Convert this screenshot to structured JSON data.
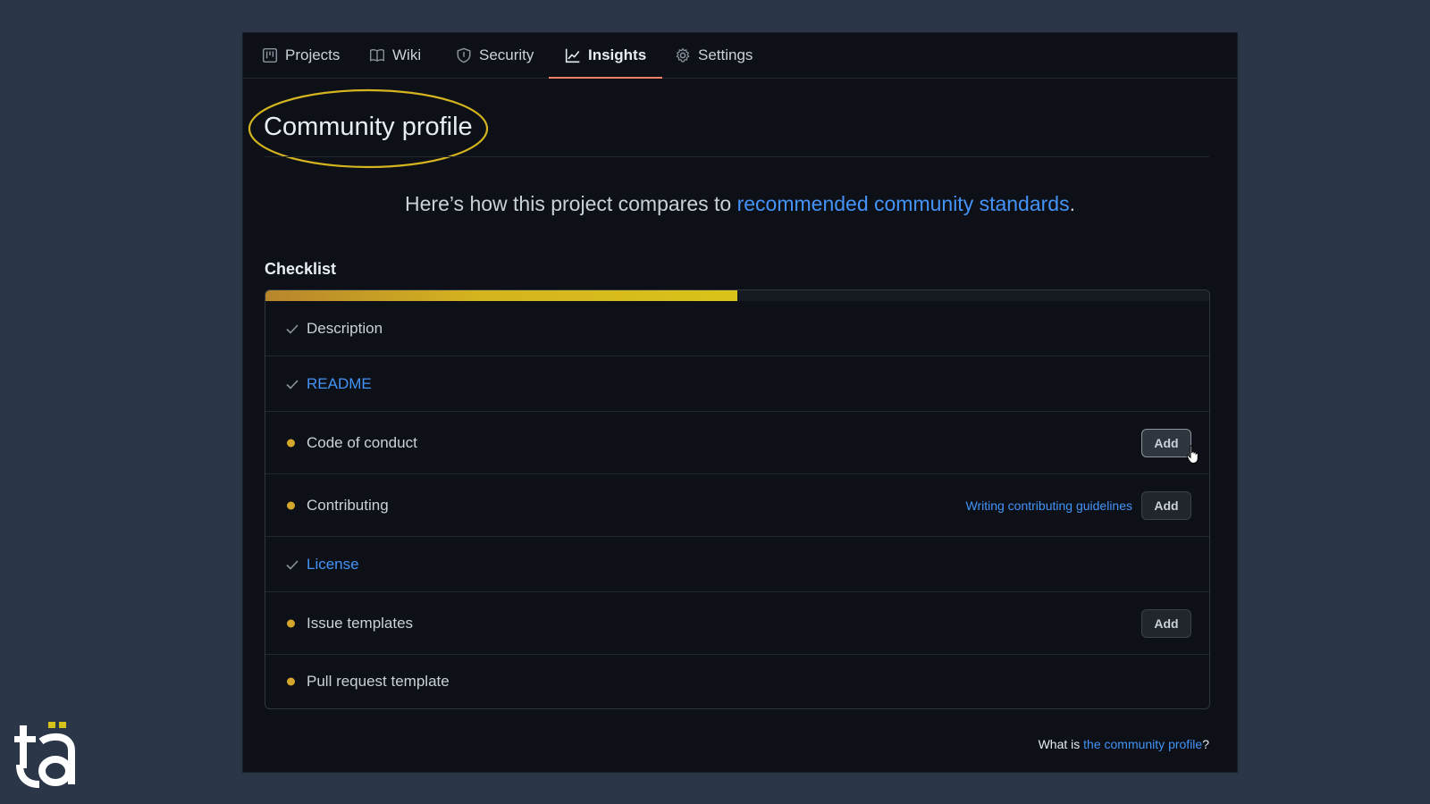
{
  "tabs": [
    {
      "label": "Projects",
      "icon": "project-icon"
    },
    {
      "label": "Wiki",
      "icon": "book-icon"
    },
    {
      "label": "Security",
      "icon": "shield-icon"
    },
    {
      "label": "Insights",
      "icon": "graph-icon",
      "active": true
    },
    {
      "label": "Settings",
      "icon": "gear-icon"
    }
  ],
  "page": {
    "title": "Community profile",
    "intro_text": "Here’s how this project compares to ",
    "intro_link": "recommended community standards",
    "intro_end": "."
  },
  "checklist": {
    "heading": "Checklist",
    "progress_fraction": 0.5,
    "items": [
      {
        "label": "Description",
        "status": "done",
        "link": false
      },
      {
        "label": "README",
        "status": "done",
        "link": true
      },
      {
        "label": "Code of conduct",
        "status": "missing",
        "link": false,
        "action": "Add"
      },
      {
        "label": "Contributing",
        "status": "missing",
        "link": false,
        "action": "Add",
        "guide": "Writing contributing guidelines"
      },
      {
        "label": "License",
        "status": "done",
        "link": true
      },
      {
        "label": "Issue templates",
        "status": "missing",
        "link": false,
        "action": "Add"
      },
      {
        "label": "Pull request template",
        "status": "missing",
        "link": false
      }
    ]
  },
  "footer": {
    "prefix": "What is ",
    "link": "the community profile",
    "suffix": "?"
  },
  "colors": {
    "accent_link": "#4493f8",
    "tab_underline": "#f78166",
    "missing_dot": "#d4a72c",
    "highlight_ellipse": "#d4b41f"
  },
  "logo_text": "ta"
}
